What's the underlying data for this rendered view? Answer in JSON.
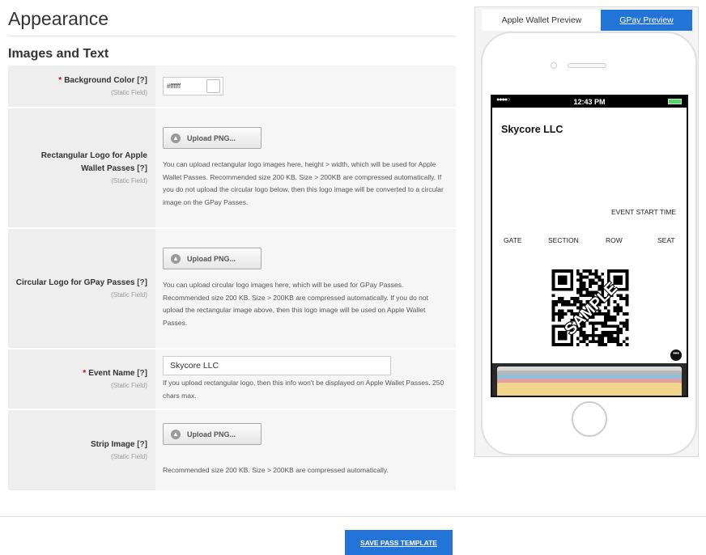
{
  "page": {
    "title": "Appearance",
    "section_title": "Images and Text",
    "static_field_text": "(Static Field)",
    "required_marker": "*",
    "help_marker": "[?]"
  },
  "form": {
    "background_color": {
      "label": "Background Color",
      "value": "#ffffff"
    },
    "rect_logo": {
      "label_line1": "Rectangular Logo for Apple",
      "label_line2": "Wallet Passes",
      "button_label": "Upload PNG...",
      "hint": "You can upload rectangular logo images here, height > width, which will be used for Apple Wallet Passes. Recommended size 200 KB. Size > 200KB are compressed automatically. If you do not upload the circular logo below, then this logo image will be converted to a circular image on the GPay Passes."
    },
    "circ_logo": {
      "label": "Circular Logo for GPay Passes",
      "button_label": "Upload PNG...",
      "hint": "You can upload circular logo images here, which will be used for GPay Passes. Recommended size 200 KB. Size > 200KB are compressed automatically. If you do not upload the rectangular image above, then this logo image will be used on Apple Wallet Passes."
    },
    "event_name": {
      "label": "Event Name",
      "value": "Skycore LLC",
      "hint": "If you upload rectangular logo, then this info won't be displayed on Apple Wallet Passes. 250 chars max."
    },
    "strip_image": {
      "label": "Strip Image",
      "button_label": "Upload PNG...",
      "hint": "Recommended size 200 KB. Size > 200KB are compressed automatically."
    }
  },
  "footer": {
    "save_label": "SAVE PASS TEMPLATE"
  },
  "preview": {
    "tabs": {
      "apple": "Apple Wallet Preview",
      "gpay": "GPay Preview"
    },
    "status_time": "12:43 PM",
    "status_signal": "●●●●○",
    "pass_name": "Skycore LLC",
    "event_start_label": "EVENT START TIME",
    "fields": [
      "GATE",
      "SECTION",
      "ROW",
      "SEAT"
    ],
    "qr_overlay": "SAMPLE",
    "more_glyph": "•••",
    "strip_colors": [
      "#d9d9d9",
      "#b7b7b7",
      "#8fc0d9",
      "#e3a0a0",
      "#f0d58c"
    ]
  },
  "colors": {
    "accent": "#2275d7",
    "required": "#d0021b"
  }
}
